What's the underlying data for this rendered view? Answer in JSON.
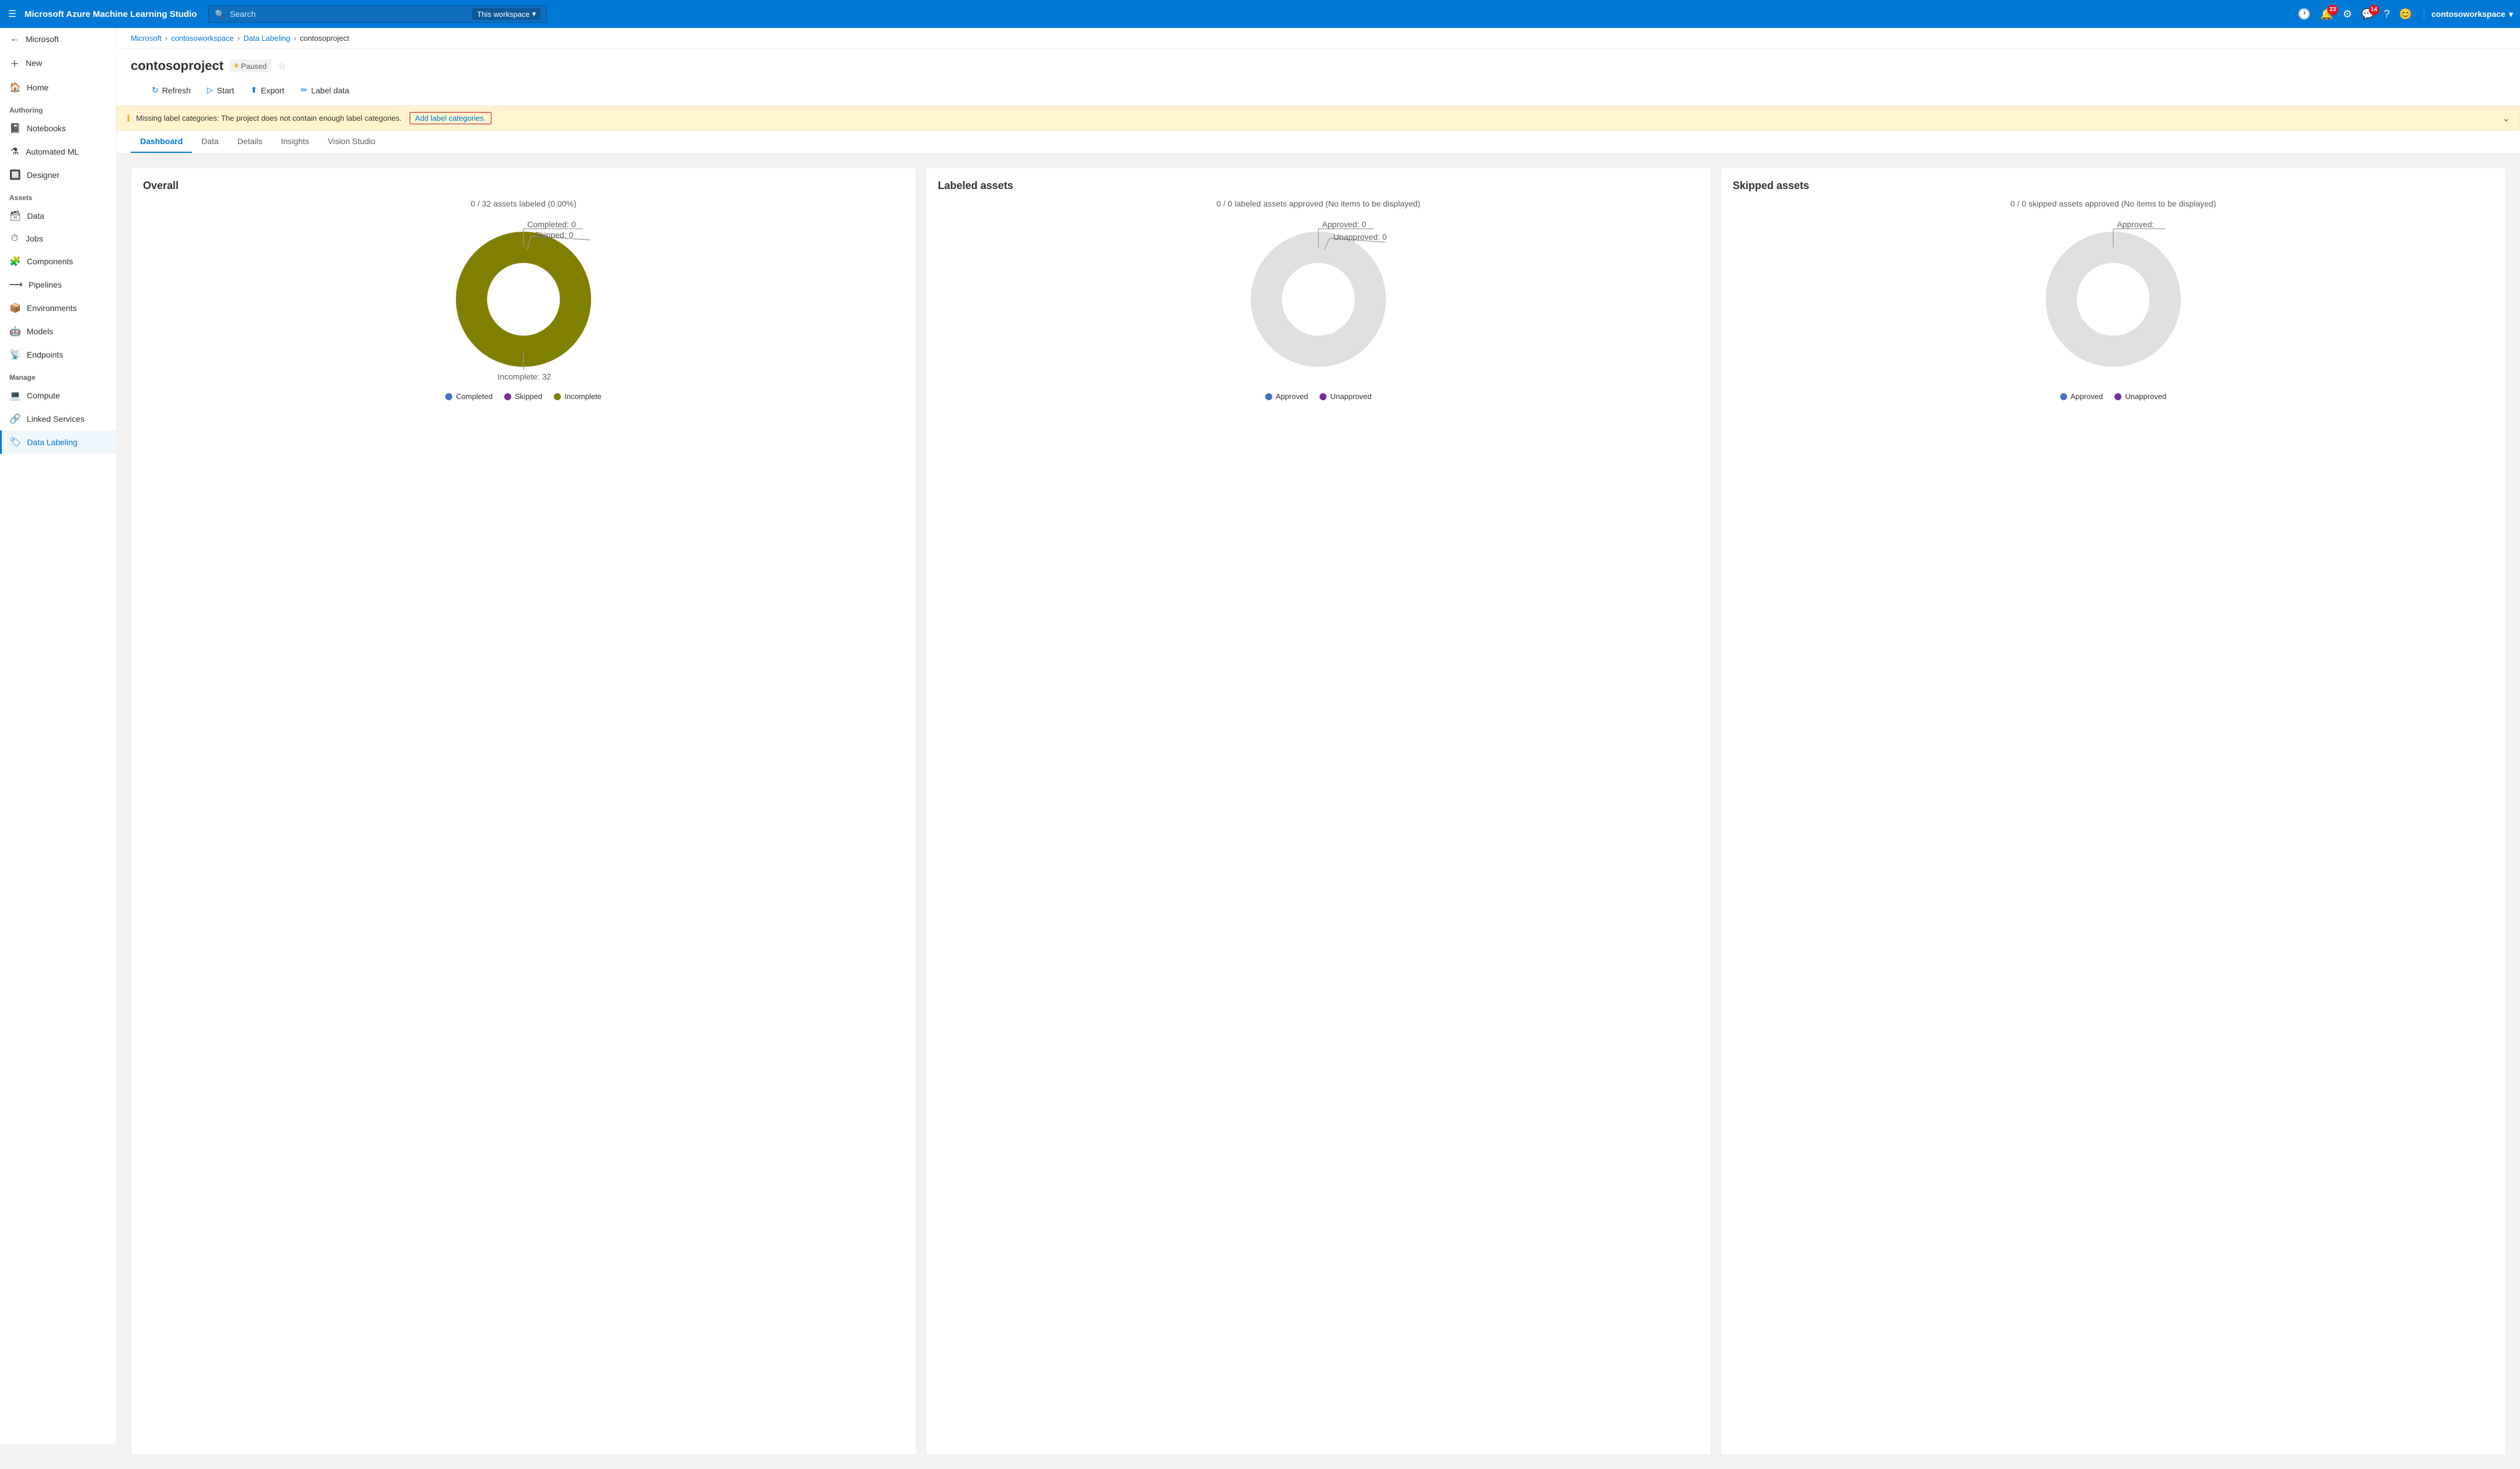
{
  "app": {
    "title": "Microsoft Azure Machine Learning Studio"
  },
  "topnav": {
    "logo": "Microsoft Azure Machine Learning Studio",
    "search_placeholder": "Search",
    "search_workspace": "This workspace",
    "icons": {
      "clock": "🕐",
      "notifications_count": "23",
      "settings": "⚙",
      "feedback_count": "14",
      "help": "?",
      "avatar": "😊"
    },
    "workspace": "contosoworkspace"
  },
  "sidebar": {
    "hamburger": "☰",
    "microsoft": "Microsoft",
    "new_label": "New",
    "home_label": "Home",
    "sections": {
      "authoring": "Authoring",
      "assets": "Assets",
      "manage": "Manage"
    },
    "items": {
      "notebooks": "Notebooks",
      "automated_ml": "Automated ML",
      "designer": "Designer",
      "data": "Data",
      "jobs": "Jobs",
      "components": "Components",
      "pipelines": "Pipelines",
      "environments": "Environments",
      "models": "Models",
      "endpoints": "Endpoints",
      "compute": "Compute",
      "linked_services": "Linked Services",
      "data_labeling": "Data Labeling"
    }
  },
  "breadcrumb": {
    "items": [
      "Microsoft",
      "contosoworkspace",
      "Data Labeling",
      "contosoproject"
    ]
  },
  "page": {
    "title": "contosoproject",
    "status": "Paused",
    "toolbar": {
      "refresh": "Refresh",
      "start": "Start",
      "export": "Export",
      "label_data": "Label data"
    },
    "warning": {
      "text": "Missing label categories: The project does not contain enough label categories.",
      "link_text": "Add label categories.",
      "icon": "ℹ"
    }
  },
  "tabs": {
    "items": [
      "Dashboard",
      "Data",
      "Details",
      "Insights",
      "Vision Studio"
    ],
    "active": "Dashboard"
  },
  "dashboard": {
    "cards": [
      {
        "id": "overall",
        "title": "Overall",
        "subtitle": "0 / 32 assets labeled (0.00%)",
        "chart_type": "donut",
        "annotations": [
          {
            "label": "Completed: 0",
            "angle": -40
          },
          {
            "label": "Skipped: 0",
            "angle": -20
          }
        ],
        "segments": [
          {
            "label": "Completed",
            "value": 0,
            "color": "#4472c4"
          },
          {
            "label": "Skipped",
            "value": 0,
            "color": "#7030a0"
          },
          {
            "label": "Incomplete",
            "value": 32,
            "color": "#808000"
          }
        ],
        "incomplete_label": "Incomplete: 32",
        "legend": [
          {
            "label": "Completed",
            "color": "#4472c4"
          },
          {
            "label": "Skipped",
            "color": "#7030a0"
          },
          {
            "label": "Incomplete",
            "color": "#808000"
          }
        ]
      },
      {
        "id": "labeled",
        "title": "Labeled assets",
        "subtitle": "0 / 0 labeled assets approved (No items to be displayed)",
        "chart_type": "donut_empty",
        "annotations": [
          {
            "label": "Approved: 0"
          },
          {
            "label": "Unapproved: 0"
          }
        ],
        "segments": [
          {
            "label": "Approved",
            "value": 0,
            "color": "#4472c4"
          },
          {
            "label": "Unapproved",
            "value": 0,
            "color": "#7030a0"
          }
        ],
        "legend": [
          {
            "label": "Approved",
            "color": "#4472c4"
          },
          {
            "label": "Unapproved",
            "color": "#7030a0"
          }
        ]
      },
      {
        "id": "skipped",
        "title": "Skipped assets",
        "subtitle": "0 / 0 skipped assets approved (No items to be displayed)",
        "chart_type": "donut_empty",
        "annotations": [
          {
            "label": "Approved:"
          }
        ],
        "segments": [
          {
            "label": "Approved",
            "value": 0,
            "color": "#4472c4"
          },
          {
            "label": "Unapproved",
            "value": 0,
            "color": "#7030a0"
          }
        ],
        "legend": [
          {
            "label": "Approved",
            "color": "#4472c4"
          },
          {
            "label": "Unapproved",
            "color": "#7030a0"
          }
        ]
      }
    ]
  }
}
